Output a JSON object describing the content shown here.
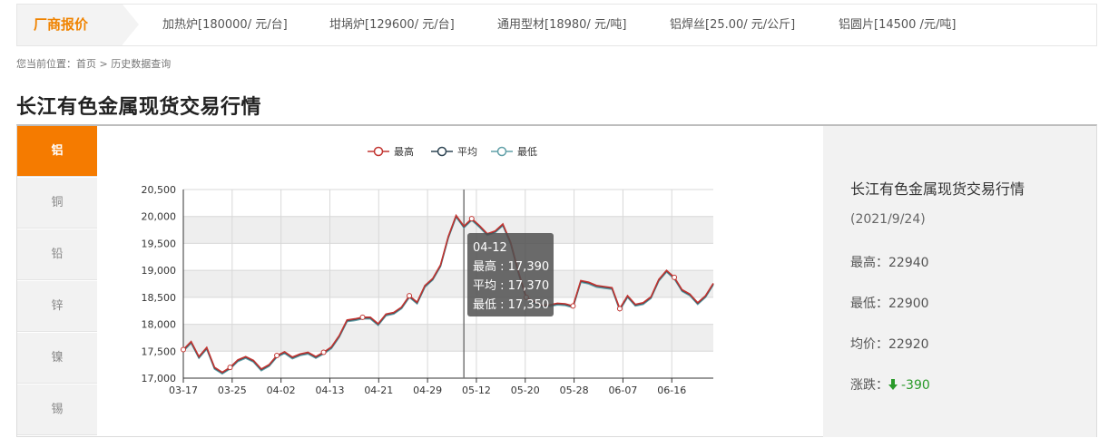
{
  "ticker": {
    "tag": "厂商报价",
    "items": [
      "加热炉[180000/ 元/台]",
      "坩埚炉[129600/ 元/台]",
      "通用型材[18980/ 元/吨]",
      "铝焊丝[25.00/ 元/公斤]",
      "铝圆片[14500 /元/吨]"
    ]
  },
  "breadcrumb": {
    "prefix": "您当前位置：",
    "home": "首页",
    "sep": " > ",
    "current": "历史数据查询"
  },
  "page_title": "长江有色金属现货交易行情",
  "tabs": [
    "铝",
    "铜",
    "铅",
    "锌",
    "镍",
    "锡"
  ],
  "active_tab": 0,
  "legend": [
    "最高",
    "平均",
    "最低"
  ],
  "tooltip": {
    "date": "04-12",
    "high": "最高 : 17,390",
    "avg": "平均 : 17,370",
    "low": "最低 : 17,350"
  },
  "summary": {
    "title": "长江有色金属现货交易行情",
    "date": "(2021/9/24)",
    "high": "最高：22940",
    "low": "最低：22900",
    "avg": "均价：22920",
    "change_label": "涨跌：",
    "change_value": "-390"
  },
  "colors": {
    "accent": "#f57b00",
    "high": "#c23531",
    "avg": "#2f4554",
    "low": "#61a0a8",
    "down": "#2a9a2a"
  },
  "chart_data": {
    "type": "line",
    "title": "",
    "ylim": [
      17000,
      20500
    ],
    "y_ticks": [
      17000,
      17500,
      18000,
      18500,
      19000,
      19500,
      20000,
      20500
    ],
    "y_tick_labels": [
      "17,000",
      "17,500",
      "18,000",
      "18,500",
      "19,000",
      "19,500",
      "20,000",
      "20,500"
    ],
    "x_tick_labels": [
      "03-17",
      "03-25",
      "04-02",
      "04-13",
      "04-21",
      "04-29",
      "05-12",
      "05-20",
      "05-28",
      "06-07",
      "06-16"
    ],
    "legend_position": "top-center",
    "grid": true,
    "series": [
      {
        "name": "最高",
        "values": [
          17530,
          17680,
          17400,
          17570,
          17200,
          17110,
          17200,
          17340,
          17400,
          17330,
          17170,
          17250,
          17420,
          17490,
          17390,
          17450,
          17480,
          17400,
          17480,
          17580,
          17790,
          18080,
          18100,
          18130,
          18130,
          18010,
          18190,
          18220,
          18320,
          18530,
          18410,
          18720,
          18850,
          19100,
          19630,
          20020,
          19820,
          19960,
          19830,
          19680,
          19730,
          19860,
          19520,
          18970,
          18500,
          18420,
          18350,
          18360,
          18390,
          18380,
          18340,
          18810,
          18780,
          18720,
          18700,
          18680,
          18290,
          18530,
          18370,
          18400,
          18510,
          18830,
          19000,
          18870,
          18640,
          18560,
          18400,
          18530,
          18760
        ]
      },
      {
        "name": "平均",
        "values": [
          17520,
          17670,
          17390,
          17560,
          17190,
          17100,
          17190,
          17330,
          17390,
          17320,
          17160,
          17240,
          17410,
          17480,
          17380,
          17440,
          17470,
          17390,
          17470,
          17570,
          17780,
          18070,
          18090,
          18120,
          18120,
          18000,
          18180,
          18210,
          18310,
          18520,
          18400,
          18710,
          18840,
          19090,
          19620,
          20010,
          19810,
          19950,
          19820,
          19670,
          19720,
          19850,
          19510,
          18960,
          18490,
          18410,
          18340,
          18350,
          18380,
          18370,
          18330,
          18800,
          18770,
          18710,
          18690,
          18670,
          18280,
          18520,
          18360,
          18390,
          18500,
          18820,
          18990,
          18860,
          18630,
          18550,
          18390,
          18520,
          18750
        ]
      },
      {
        "name": "最低",
        "values": [
          17500,
          17650,
          17370,
          17540,
          17170,
          17080,
          17170,
          17310,
          17370,
          17300,
          17140,
          17220,
          17390,
          17460,
          17360,
          17420,
          17450,
          17370,
          17450,
          17550,
          17760,
          18050,
          18070,
          18100,
          18100,
          17980,
          18160,
          18190,
          18290,
          18500,
          18380,
          18690,
          18820,
          19070,
          19600,
          19990,
          19790,
          19930,
          19800,
          19650,
          19700,
          19830,
          19490,
          18940,
          18470,
          18390,
          18320,
          18330,
          18360,
          18350,
          18310,
          18780,
          18750,
          18690,
          18670,
          18650,
          18260,
          18500,
          18340,
          18370,
          18480,
          18800,
          18970,
          18840,
          18610,
          18530,
          18370,
          18500,
          18730
        ]
      }
    ]
  }
}
